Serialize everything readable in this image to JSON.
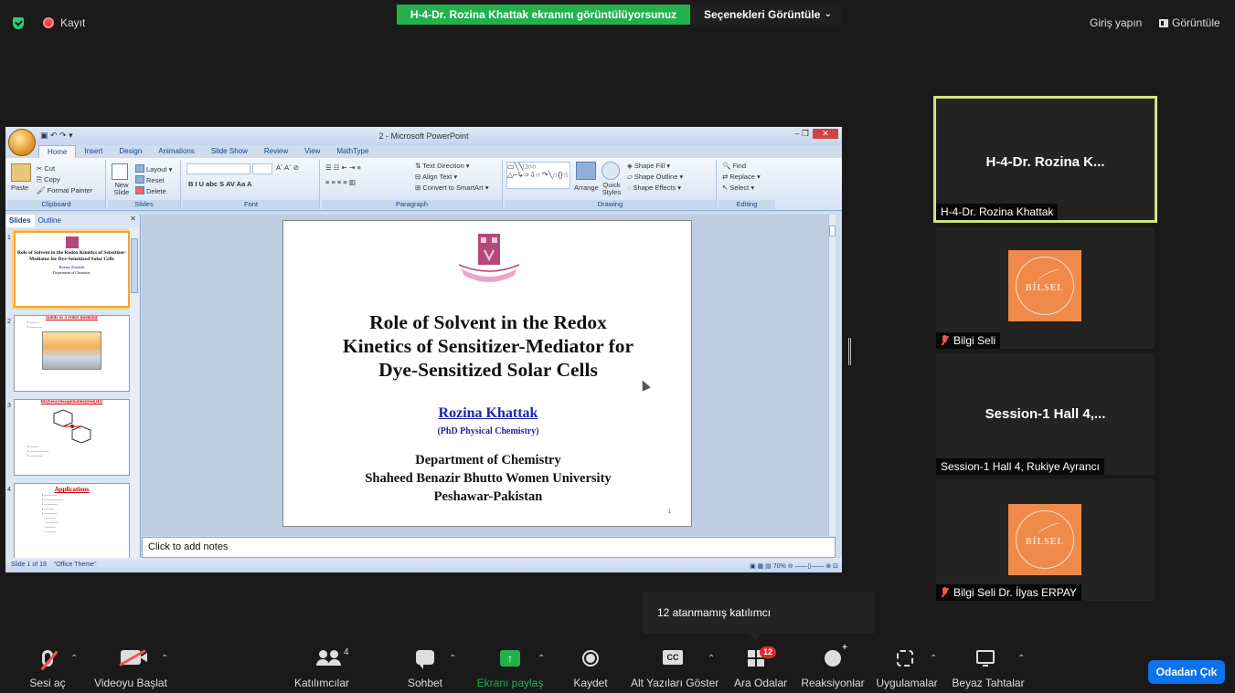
{
  "topbar": {
    "record_label": "Kayıt",
    "viewing_banner": "H-4-Dr. Rozina Khattak ekranını görüntülüyorsunuz",
    "view_options": "Seçenekleri Görüntüle",
    "sign_in": "Giriş yapın",
    "view": "Görüntüle"
  },
  "powerpoint": {
    "window_title": "2 - Microsoft PowerPoint",
    "tabs": [
      "Home",
      "Insert",
      "Design",
      "Animations",
      "Slide Show",
      "Review",
      "View",
      "MathType"
    ],
    "ribbon": {
      "paste": "Paste",
      "cut": "Cut",
      "copy": "Copy",
      "format_painter": "Format Painter",
      "clipboard": "Clipboard",
      "new_slide": "New Slide",
      "layout": "Layout",
      "reset": "Reset",
      "delete": "Delete",
      "slides_group": "Slides",
      "font_group": "Font",
      "text_direction": "Text Direction",
      "align_text": "Align Text",
      "convert_smartart": "Convert to SmartArt",
      "paragraph_group": "Paragraph",
      "arrange": "Arrange",
      "quick_styles": "Quick Styles",
      "shape_fill": "Shape Fill",
      "shape_outline": "Shape Outline",
      "shape_effects": "Shape Effects",
      "drawing_group": "Drawing",
      "find": "Find",
      "replace": "Replace",
      "select": "Select",
      "editing_group": "Editing"
    },
    "pane_tabs": [
      "Slides",
      "Outline"
    ],
    "thumbs": [
      {
        "num": "1",
        "title": "Role of Solvent in the Redox Kinetics of Sensitizer-Mediator for Dye-Sensitized Solar Cells",
        "sub": "Rozina Khattak",
        "dept": "Department of Chemistry"
      },
      {
        "num": "2",
        "title": "Iodide as a redox mediator"
      },
      {
        "num": "3",
        "title": "Bis(benzylisoquinoline)iron(III)"
      },
      {
        "num": "4",
        "title": "Applications"
      }
    ],
    "slide": {
      "title_line1": "Role of Solvent in the Redox",
      "title_line2": "Kinetics of Sensitizer-Mediator for",
      "title_line3": "Dye-Sensitized Solar Cells",
      "author": "Rozina Khattak",
      "degree": "(PhD Physical Chemistry)",
      "dept_line1": "Department of Chemistry",
      "dept_line2": "Shaheed Benazir Bhutto Women University",
      "dept_line3": "Peshawar-Pakistan",
      "page_number": "1"
    },
    "notes_placeholder": "Click to add notes",
    "status_slide": "Slide 1 of 19",
    "status_theme": "\"Office Theme\"",
    "zoom": "70%"
  },
  "participants": [
    {
      "tile_name": "H-4-Dr. Rozina K...",
      "label": "H-4-Dr. Rozina Khattak",
      "muted": false
    },
    {
      "label": "Bilgi Seli",
      "muted": true
    },
    {
      "tile_name": "Session-1 Hall 4,...",
      "label": "Session-1 Hall 4, Rukiye Ayrancı",
      "muted": false
    },
    {
      "label": "Bilgi Seli Dr. İlyas ERPAY",
      "muted": true
    }
  ],
  "avatar_text": "BİLSEL",
  "tooltip": "12 atanmamış katılımcı",
  "toolbar": {
    "unmute": "Sesi aç",
    "start_video": "Videoyu Başlat",
    "participants": "Katılımcılar",
    "participants_count": "4",
    "chat": "Sohbet",
    "share_screen": "Ekranı paylaş",
    "record": "Kaydet",
    "captions": "Alt Yazıları Göster",
    "captions_icon": "CC",
    "breakout_rooms": "Ara Odalar",
    "breakout_badge": "12",
    "reactions": "Reaksiyonlar",
    "apps": "Uygulamalar",
    "whiteboards": "Beyaz Tahtalar",
    "leave": "Odadan Çık"
  },
  "colors": {
    "share_green": "#22b14c",
    "active_speaker": "#cde57d",
    "leave_blue": "#0e72ed",
    "badge_red": "#e02828",
    "avatar_orange": "#f08a4b"
  }
}
